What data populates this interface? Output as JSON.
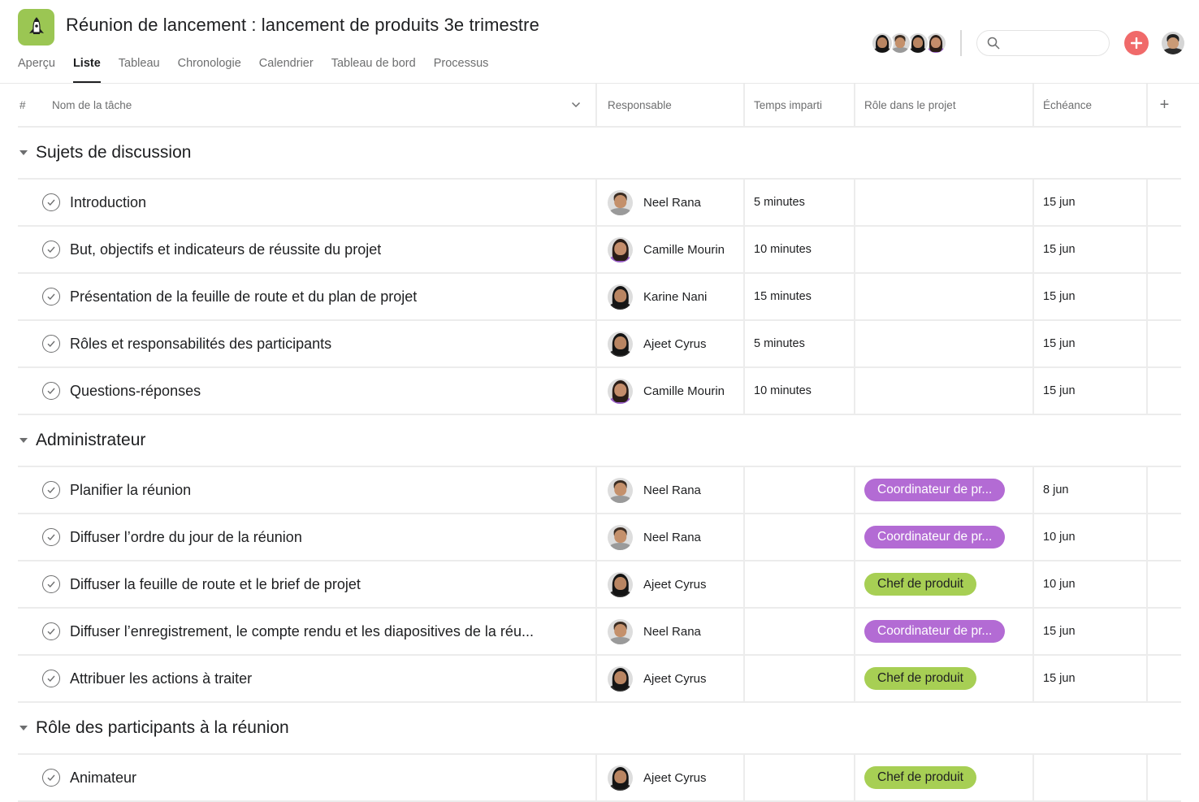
{
  "project": {
    "title": "Réunion de lancement : lancement de produits 3e trimestre",
    "icon": "rocket-icon",
    "icon_color": "#9bc653"
  },
  "tabs": [
    {
      "label": "Aperçu",
      "active": false
    },
    {
      "label": "Liste",
      "active": true
    },
    {
      "label": "Tableau",
      "active": false
    },
    {
      "label": "Chronologie",
      "active": false
    },
    {
      "label": "Calendrier",
      "active": false
    },
    {
      "label": "Tableau de bord",
      "active": false
    },
    {
      "label": "Processus",
      "active": false
    }
  ],
  "toolbar": {
    "members": [
      "member-avatar-1",
      "member-avatar-2",
      "member-avatar-3",
      "member-avatar-4"
    ],
    "search_placeholder": "",
    "search_value": "",
    "add_color": "#f06a6a"
  },
  "columns": {
    "hash": "#",
    "name": "Nom de la tâche",
    "responsible": "Responsable",
    "time": "Temps imparti",
    "role": "Rôle dans le projet",
    "due": "Échéance",
    "add": "+"
  },
  "role_colors": {
    "purple": "#b36bd4",
    "green": "#a7cf54"
  },
  "sections": [
    {
      "title": "Sujets de discussion",
      "tasks": [
        {
          "name": "Introduction",
          "assignee": "Neel Rana",
          "avatar": "male",
          "time": "5 minutes",
          "role": "",
          "role_color": "",
          "due": "15 jun"
        },
        {
          "name": "But, objectifs et indicateurs de réussite du projet",
          "assignee": "Camille Mourin",
          "avatar": "female-a",
          "time": "10 minutes",
          "role": "",
          "role_color": "",
          "due": "15 jun"
        },
        {
          "name": "Présentation de la feuille de route et du plan de projet",
          "assignee": "Karine Nani",
          "avatar": "female-b",
          "time": "15 minutes",
          "role": "",
          "role_color": "",
          "due": "15 jun"
        },
        {
          "name": "Rôles et responsabilités des participants",
          "assignee": "Ajeet Cyrus",
          "avatar": "female-c",
          "time": "5 minutes",
          "role": "",
          "role_color": "",
          "due": "15 jun"
        },
        {
          "name": "Questions-réponses",
          "assignee": "Camille Mourin",
          "avatar": "female-a",
          "time": "10 minutes",
          "role": "",
          "role_color": "",
          "due": "15 jun"
        }
      ]
    },
    {
      "title": "Administrateur",
      "tasks": [
        {
          "name": "Planifier la réunion",
          "assignee": "Neel Rana",
          "avatar": "male",
          "time": "",
          "role": "Coordinateur de pr...",
          "role_color": "purple",
          "due": "8 jun"
        },
        {
          "name": "Diffuser l’ordre du jour de la réunion",
          "assignee": "Neel Rana",
          "avatar": "male",
          "time": "",
          "role": "Coordinateur de pr...",
          "role_color": "purple",
          "due": "10 jun"
        },
        {
          "name": "Diffuser la feuille de route et le brief de projet",
          "assignee": "Ajeet Cyrus",
          "avatar": "female-c",
          "time": "",
          "role": "Chef de produit",
          "role_color": "green",
          "due": "10 jun"
        },
        {
          "name": "Diffuser l’enregistrement, le compte rendu et les diapositives de la réu...",
          "assignee": "Neel Rana",
          "avatar": "male",
          "time": "",
          "role": "Coordinateur de pr...",
          "role_color": "purple",
          "due": "15 jun"
        },
        {
          "name": "Attribuer les actions à traiter",
          "assignee": "Ajeet Cyrus",
          "avatar": "female-c",
          "time": "",
          "role": "Chef de produit",
          "role_color": "green",
          "due": "15 jun"
        }
      ]
    },
    {
      "title": "Rôle des participants à la réunion",
      "tasks": [
        {
          "name": "Animateur",
          "assignee": "Ajeet Cyrus",
          "avatar": "female-c",
          "time": "",
          "role": "Chef de produit",
          "role_color": "green",
          "due": ""
        }
      ]
    }
  ]
}
